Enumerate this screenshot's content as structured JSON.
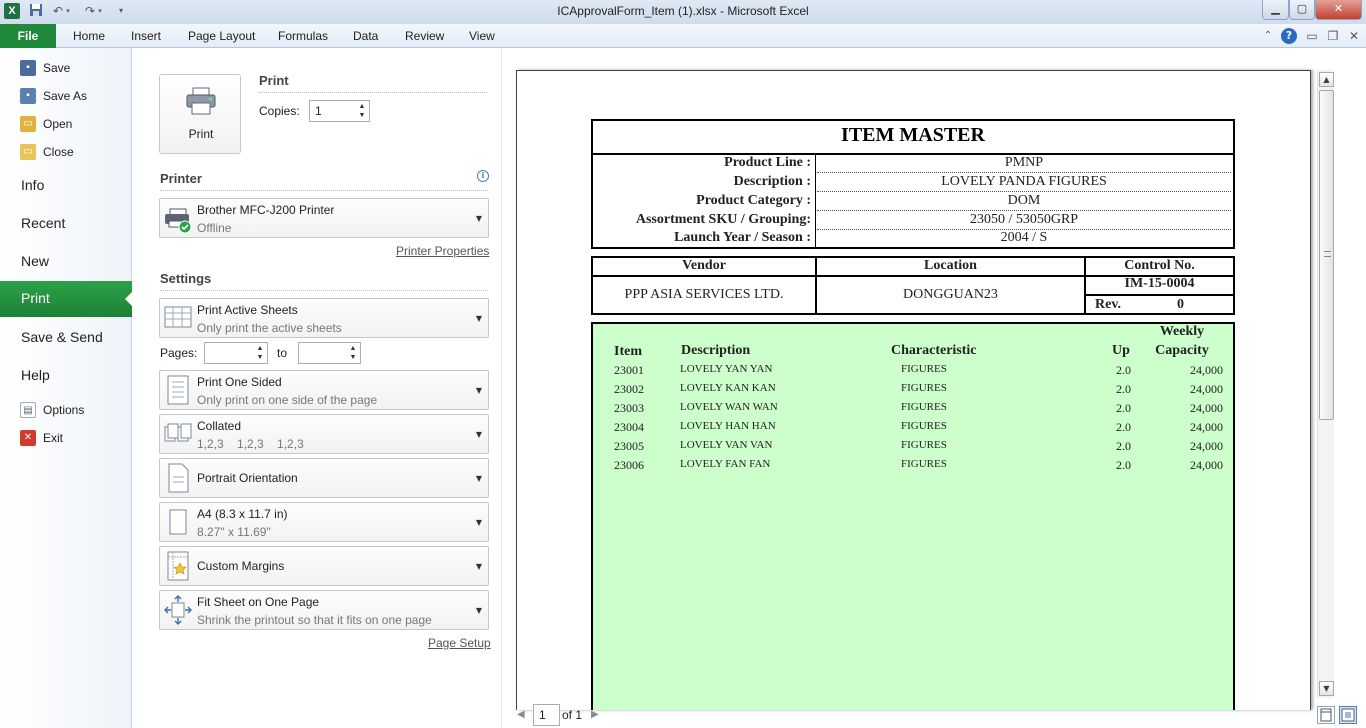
{
  "window": {
    "title": "ICApprovalForm_Item (1).xlsx  -  Microsoft Excel",
    "app_icon": "X",
    "qat": {
      "save_icon": "save-icon",
      "undo_icon": "undo-icon",
      "redo_icon": "redo-icon",
      "customize_icon": "customize-icon"
    },
    "controls": {
      "minimize": "▁",
      "maximize": "▢",
      "close": "✕"
    }
  },
  "ribbon": {
    "file_tab": "File",
    "tabs": [
      "Home",
      "Insert",
      "Page Layout",
      "Formulas",
      "Data",
      "Review",
      "View"
    ]
  },
  "nav": {
    "save": "Save",
    "save_as": "Save As",
    "open": "Open",
    "close": "Close",
    "info": "Info",
    "recent": "Recent",
    "new": "New",
    "print": "Print",
    "save_send": "Save & Send",
    "help": "Help",
    "options": "Options",
    "exit": "Exit"
  },
  "print": {
    "heading": "Print",
    "button_label": "Print",
    "copies_label": "Copies:",
    "copies_value": "1"
  },
  "printer": {
    "heading": "Printer",
    "name": "Brother MFC-J200 Printer",
    "status": "Offline",
    "properties_link": "Printer Properties"
  },
  "settings": {
    "heading": "Settings",
    "what": {
      "title": "Print Active Sheets",
      "desc": "Only print the active sheets"
    },
    "pages_label": "Pages:",
    "pages_from": "",
    "to_label": "to",
    "pages_to": "",
    "sided": {
      "title": "Print One Sided",
      "desc": "Only print on one side of the page"
    },
    "collate": {
      "title": "Collated",
      "desc": "1,2,3    1,2,3    1,2,3"
    },
    "orientation": {
      "title": "Portrait Orientation"
    },
    "paper": {
      "title": "A4 (8.3 x 11.7 in)",
      "desc": "8.27\" x 11.69\""
    },
    "margins": {
      "title": "Custom Margins"
    },
    "scaling": {
      "title": "Fit Sheet on One Page",
      "desc": "Shrink the printout so that it fits on one page"
    },
    "page_setup_link": "Page Setup"
  },
  "sheet": {
    "title": "ITEM MASTER",
    "fields": [
      {
        "label": "Product Line :",
        "value": "PMNP"
      },
      {
        "label": "Description :",
        "value": "LOVELY PANDA FIGURES"
      },
      {
        "label": "Product Category :",
        "value": "DOM"
      },
      {
        "label": "Assortment SKU / Grouping:",
        "value": "23050 / 53050GRP"
      },
      {
        "label": "Launch Year / Season :",
        "value": "2004 / S"
      }
    ],
    "vendor_header": "Vendor",
    "location_header": "Location",
    "control_header": "Control No.",
    "vendor": "PPP ASIA SERVICES LTD.",
    "location": "DONGGUAN23",
    "control_no": "IM-15-0004",
    "rev_label": "Rev.",
    "rev_value": "0",
    "items_header": {
      "item": "Item",
      "description": "Description",
      "characteristic": "Characteristic",
      "up": "Up",
      "weekly": "Weekly",
      "capacity": "Capacity"
    },
    "items": [
      {
        "item": "23001",
        "description": "LOVELY YAN YAN",
        "characteristic": "FIGURES",
        "up": "2.0",
        "capacity": "24,000"
      },
      {
        "item": "23002",
        "description": "LOVELY KAN KAN",
        "characteristic": "FIGURES",
        "up": "2.0",
        "capacity": "24,000"
      },
      {
        "item": "23003",
        "description": "LOVELY WAN WAN",
        "characteristic": "FIGURES",
        "up": "2.0",
        "capacity": "24,000"
      },
      {
        "item": "23004",
        "description": "LOVELY HAN HAN",
        "characteristic": "FIGURES",
        "up": "2.0",
        "capacity": "24,000"
      },
      {
        "item": "23005",
        "description": "LOVELY VAN VAN",
        "characteristic": "FIGURES",
        "up": "2.0",
        "capacity": "24,000"
      },
      {
        "item": "23006",
        "description": "LOVELY FAN FAN",
        "characteristic": "FIGURES",
        "up": "2.0",
        "capacity": "24,000"
      }
    ],
    "items_bg": "#ccffcc"
  },
  "pager": {
    "current": "1",
    "of_text": "of 1"
  },
  "colors": {
    "file_green": "#1f8a3a",
    "print_green": "#2ca24a"
  }
}
